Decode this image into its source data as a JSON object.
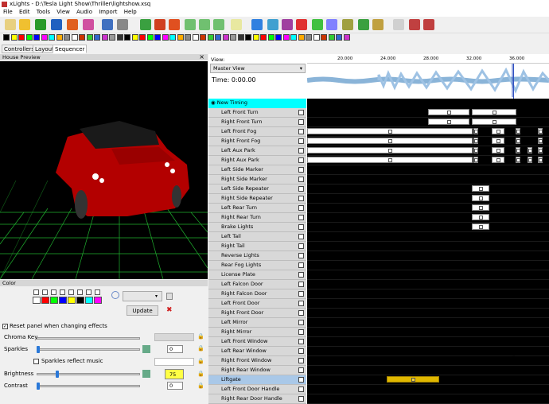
{
  "window": {
    "title": "xLights - D:\\Tesla Light Show\\Thriller\\lightshow.xsq"
  },
  "menu": [
    "File",
    "Edit",
    "Tools",
    "View",
    "Audio",
    "Import",
    "Help"
  ],
  "tabs": [
    "Controllers",
    "Layout",
    "Sequencer"
  ],
  "house_preview": {
    "title": "House Preview",
    "close": "×"
  },
  "view": {
    "label": "View:",
    "selected": "Master View",
    "time": "Time: 0:00.00"
  },
  "ruler": {
    "ticks": [
      "20.000",
      "24.000",
      "28.000",
      "32.000",
      "36.000"
    ]
  },
  "timing_track": "New Timing",
  "rows": [
    "Left Front Turn",
    "Right Front Turn",
    "Left Front Fog",
    "Right Front Fog",
    "Left Aux Park",
    "Right Aux Park",
    "Left Side Marker",
    "Right Side Marker",
    "Left Side Repeater",
    "Right Side Repeater",
    "Left Rear Turn",
    "Right Rear Turn",
    "Brake Lights",
    "Left Tail",
    "Right Tail",
    "Reverse Lights",
    "Rear Fog Lights",
    "License Plate",
    "Left Falcon Door",
    "Right Falcon Door",
    "Left Front Door",
    "Right Front Door",
    "Left Mirror",
    "Right Mirror",
    "Left Front Window",
    "Left Rear Window",
    "Right Front Window",
    "Right Rear Window",
    "Liftgate",
    "Left Front Door Handle",
    "Right Rear Door Handle"
  ],
  "color_panel": {
    "title": "Color",
    "update_label": "Update",
    "reset_label": "Reset panel when changing effects",
    "chroma_label": "Chroma Key",
    "sparkles_label": "Sparkles",
    "sparkles_value": "0",
    "sparkles_music_label": "Sparkles reflect music",
    "brightness_label": "Brightness",
    "brightness_value": "75",
    "contrast_label": "Contrast",
    "contrast_value": "0",
    "palette": [
      "#ffffff",
      "#ff0000",
      "#00ff00",
      "#0000ff",
      "#ffff00",
      "#000000",
      "#00ffff",
      "#ff00ff"
    ]
  },
  "colors": {
    "timing": "#00ffff",
    "selected_row": "#a9c8e8",
    "liftgate_effect": "#e0b800",
    "brightness_highlight": "#ffff44"
  }
}
